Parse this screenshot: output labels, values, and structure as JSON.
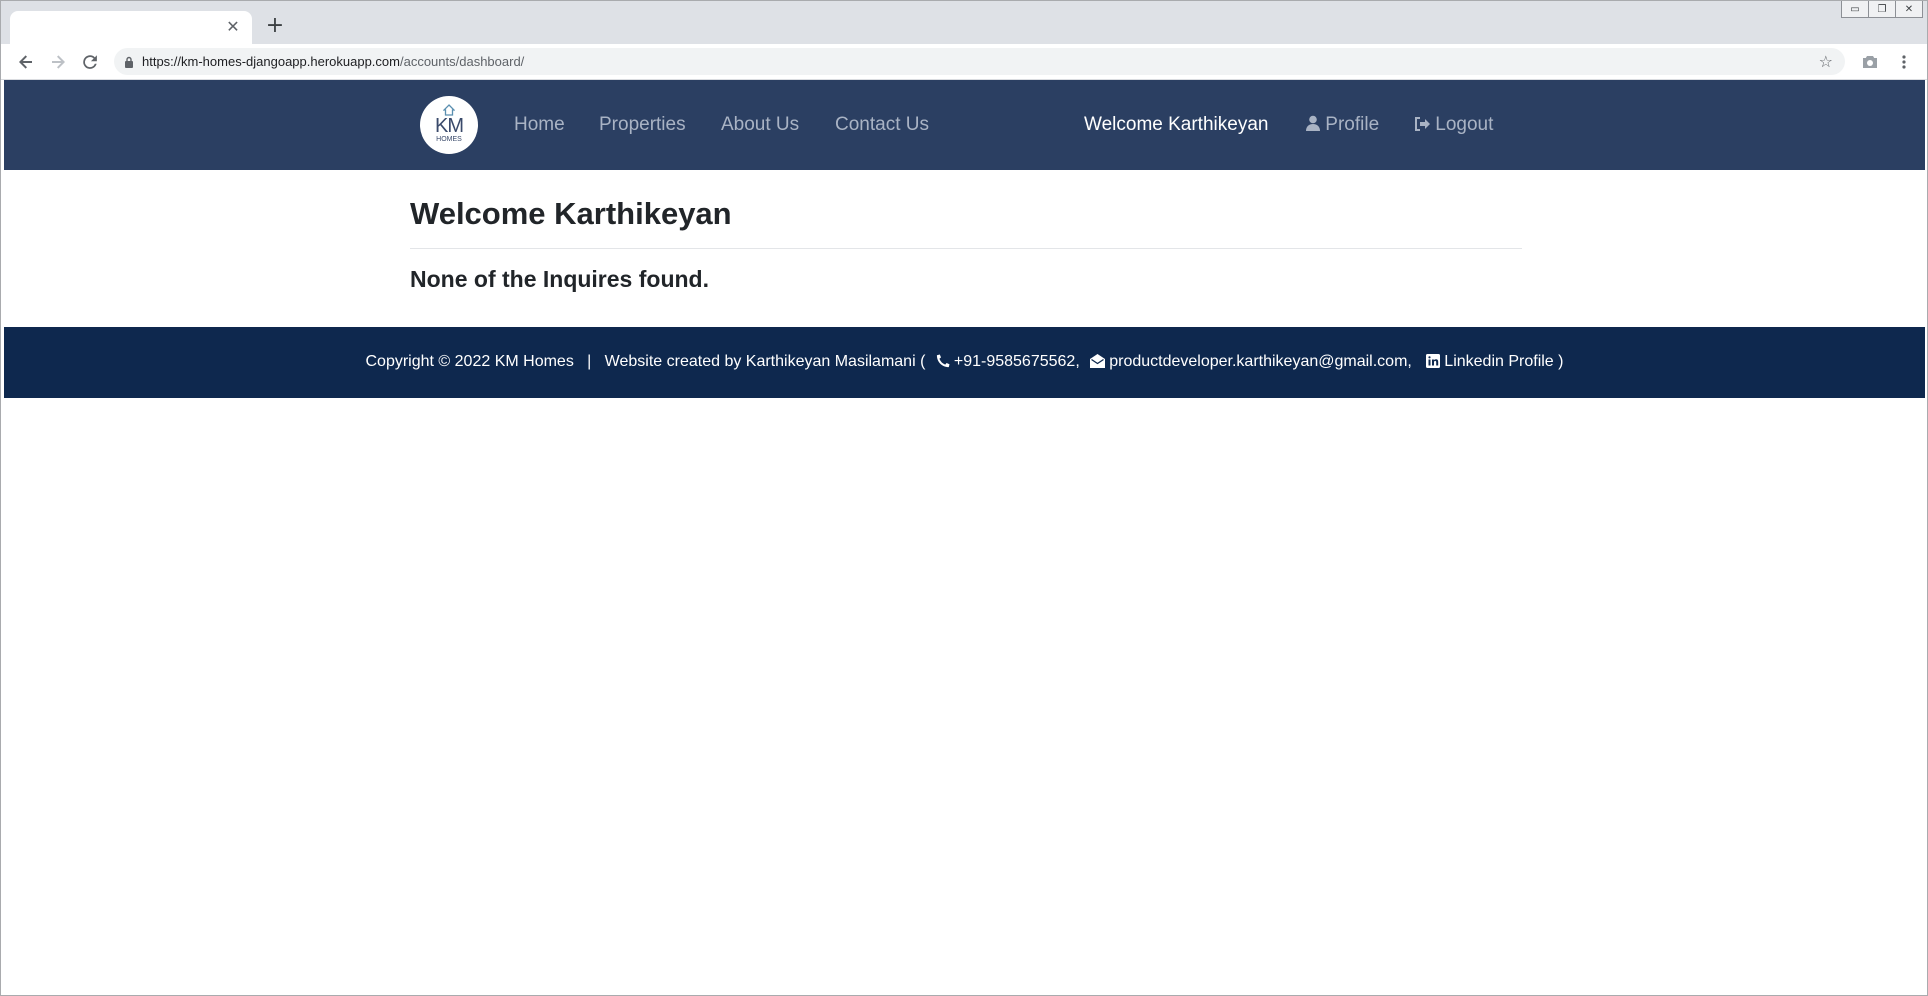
{
  "browser": {
    "tab": {
      "title": "",
      "close_glyph": "✕"
    },
    "new_tab_glyph": "+",
    "window_controls": [
      "▭",
      "❐",
      "✕"
    ],
    "url_host": "https://km-homes-djangoapp.herokuapp.com",
    "url_path": "/accounts/dashboard/",
    "icons": [
      "back-arrow-icon",
      "forward-arrow-icon",
      "reload-icon",
      "lock-icon",
      "star-icon",
      "camera-icon",
      "menu-dots-icon"
    ]
  },
  "navbar": {
    "logo": {
      "text": "KM",
      "subtext": "HOMES"
    },
    "links": [
      {
        "label": "Home"
      },
      {
        "label": "Properties"
      },
      {
        "label": "About Us"
      },
      {
        "label": "Contact Us"
      }
    ],
    "welcome": "Welcome Karthikeyan",
    "profile_label": "Profile",
    "logout_label": "Logout"
  },
  "main": {
    "title": "Welcome Karthikeyan",
    "empty_message": "None of the Inquires found."
  },
  "footer": {
    "copyright": "Copyright © 2022 KM Homes",
    "separator": "|",
    "credit": "Website created by Karthikeyan Masilamani (",
    "phone": "+91-9585675562,",
    "email": "productdeveloper.karthikeyan@gmail.com,",
    "linkedin": "Linkedin Profile",
    "closing": ")"
  },
  "colors": {
    "navbar_bg": "#2b3f62",
    "footer_bg": "#0e284e",
    "nav_link": "#a9b3c4"
  }
}
